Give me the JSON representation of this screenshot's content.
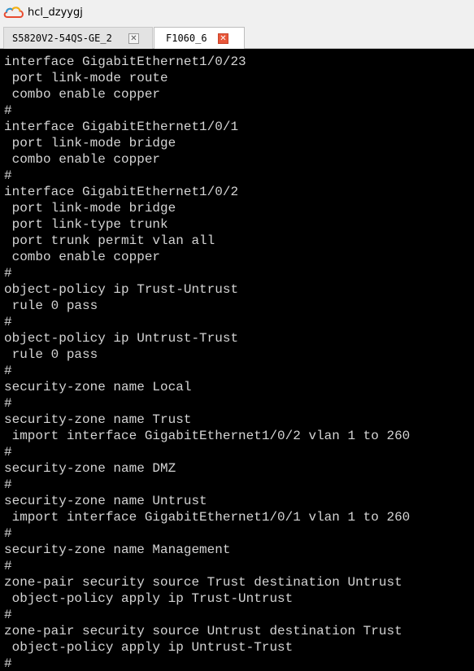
{
  "window": {
    "title": "hcl_dzyygj"
  },
  "tabs": [
    {
      "label": "S5820V2-54QS-GE_2",
      "active": false
    },
    {
      "label": "F1060_6",
      "active": true
    }
  ],
  "colors": {
    "terminal_bg": "#000000",
    "terminal_text": "#d4d4d4",
    "active_close": "#e8573a"
  },
  "terminal": {
    "lines": [
      "interface GigabitEthernet1/0/23",
      " port link-mode route",
      " combo enable copper",
      "#",
      "interface GigabitEthernet1/0/1",
      " port link-mode bridge",
      " combo enable copper",
      "#",
      "interface GigabitEthernet1/0/2",
      " port link-mode bridge",
      " port link-type trunk",
      " port trunk permit vlan all",
      " combo enable copper",
      "#",
      "object-policy ip Trust-Untrust",
      " rule 0 pass",
      "#",
      "object-policy ip Untrust-Trust",
      " rule 0 pass",
      "#",
      "security-zone name Local",
      "#",
      "security-zone name Trust",
      " import interface GigabitEthernet1/0/2 vlan 1 to 260",
      "#",
      "security-zone name DMZ",
      "#",
      "security-zone name Untrust",
      " import interface GigabitEthernet1/0/1 vlan 1 to 260",
      "#",
      "security-zone name Management",
      "#",
      "zone-pair security source Trust destination Untrust",
      " object-policy apply ip Trust-Untrust",
      "#",
      "zone-pair security source Untrust destination Trust",
      " object-policy apply ip Untrust-Trust",
      "#"
    ]
  }
}
